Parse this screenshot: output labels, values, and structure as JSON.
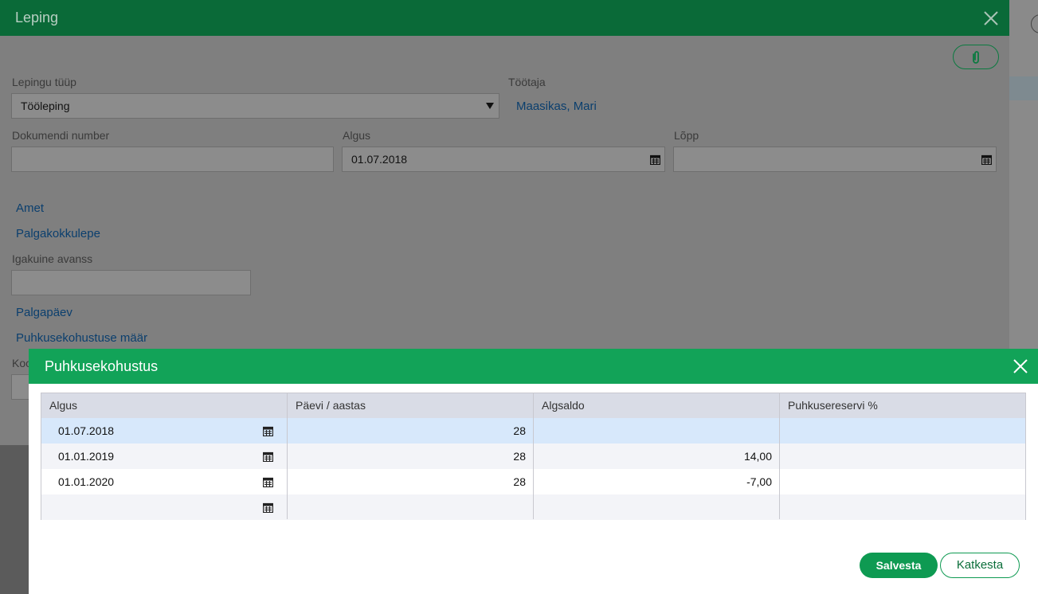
{
  "leping": {
    "title": "Leping",
    "lepingu_tyyp": {
      "label": "Lepingu tüüp",
      "value": "Tööleping"
    },
    "tootaja": {
      "label": "Töötaja",
      "value": "Maasikas, Mari"
    },
    "dokumendi_number": {
      "label": "Dokumendi number",
      "value": ""
    },
    "algus": {
      "label": "Algus",
      "value": "01.07.2018"
    },
    "lopp": {
      "label": "Lõpp",
      "value": ""
    },
    "links": {
      "amet": "Amet",
      "palgakokkulepe": "Palgakokkulepe",
      "palgapaev": "Palgapäev",
      "puhkusekohustuse_maar": "Puhkusekohustuse määr"
    },
    "igakuine_avanss": {
      "label": "Igakuine avanss",
      "value": ""
    },
    "partial_label": "Koo"
  },
  "puhkusekohustus": {
    "title": "Puhkusekohustus",
    "columns": [
      "Algus",
      "Päevi / aastas",
      "Algsaldo",
      "Puhkusereservi %"
    ],
    "rows": [
      {
        "algus": "01.07.2018",
        "paevi": "28",
        "algsaldo": "",
        "reserv": ""
      },
      {
        "algus": "01.01.2019",
        "paevi": "28",
        "algsaldo": "14,00",
        "reserv": ""
      },
      {
        "algus": "01.01.2020",
        "paevi": "28",
        "algsaldo": "-7,00",
        "reserv": ""
      },
      {
        "algus": "",
        "paevi": "",
        "algsaldo": "",
        "reserv": ""
      }
    ],
    "save_label": "Salvesta",
    "cancel_label": "Katkesta"
  },
  "colors": {
    "header_green": "#12a358",
    "selected_row": "#d7e8fb",
    "alt_row": "#f3f4f8"
  },
  "icons": [
    "close-icon",
    "paperclip-icon",
    "calendar-icon",
    "caret-down-icon"
  ]
}
